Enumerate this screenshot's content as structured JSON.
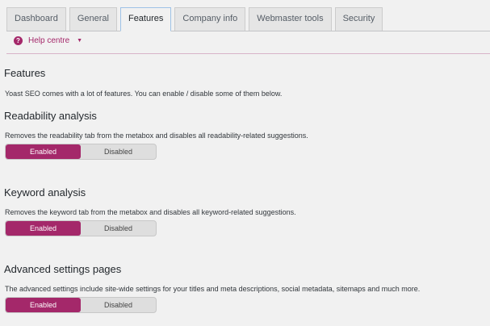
{
  "tabs": [
    {
      "label": "Dashboard",
      "active": false
    },
    {
      "label": "General",
      "active": false
    },
    {
      "label": "Features",
      "active": true
    },
    {
      "label": "Company info",
      "active": false
    },
    {
      "label": "Webmaster tools",
      "active": false
    },
    {
      "label": "Security",
      "active": false
    }
  ],
  "help": {
    "label": "Help centre",
    "icon": "question-circle-icon"
  },
  "page": {
    "title": "Features",
    "intro": "Yoast SEO comes with a lot of features. You can enable / disable some of them below."
  },
  "sections": [
    {
      "title": "Readability analysis",
      "description": "Removes the readability tab from the metabox and disables all readability-related suggestions.",
      "enabled_label": "Enabled",
      "disabled_label": "Disabled",
      "selected": "Enabled"
    },
    {
      "title": "Keyword analysis",
      "description": "Removes the keyword tab from the metabox and disables all keyword-related suggestions.",
      "enabled_label": "Enabled",
      "disabled_label": "Disabled",
      "selected": "Enabled"
    },
    {
      "title": "Advanced settings pages",
      "description": "The advanced settings include site-wide settings for your titles and meta descriptions, social metadata, sitemaps and much more.",
      "enabled_label": "Enabled",
      "disabled_label": "Disabled",
      "selected": "Enabled"
    }
  ],
  "colors": {
    "accent": "#a4286a",
    "active_tab_border": "#9ec2e6"
  }
}
